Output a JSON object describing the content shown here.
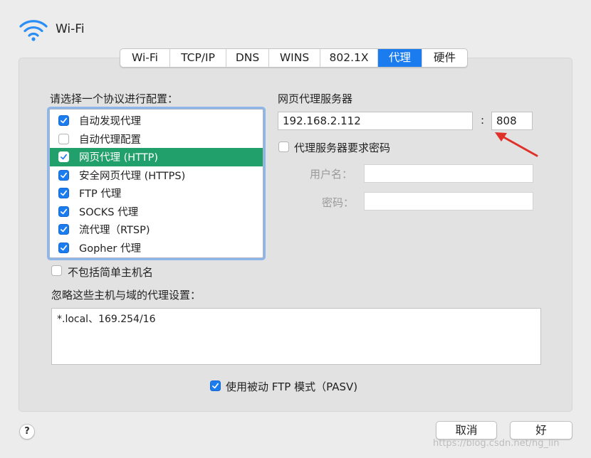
{
  "window": {
    "title": "Wi-Fi"
  },
  "tabs": [
    {
      "label": "Wi-Fi",
      "active": false
    },
    {
      "label": "TCP/IP",
      "active": false
    },
    {
      "label": "DNS",
      "active": false
    },
    {
      "label": "WINS",
      "active": false
    },
    {
      "label": "802.1X",
      "active": false
    },
    {
      "label": "代理",
      "active": true
    },
    {
      "label": "硬件",
      "active": false
    }
  ],
  "protocols": {
    "heading": "请选择一个协议进行配置：",
    "items": [
      {
        "label": "自动发现代理",
        "checked": true,
        "selected": false
      },
      {
        "label": "自动代理配置",
        "checked": false,
        "selected": false
      },
      {
        "label": "网页代理 (HTTP)",
        "checked": true,
        "selected": true
      },
      {
        "label": "安全网页代理 (HTTPS)",
        "checked": true,
        "selected": false
      },
      {
        "label": "FTP 代理",
        "checked": true,
        "selected": false
      },
      {
        "label": "SOCKS 代理",
        "checked": true,
        "selected": false
      },
      {
        "label": "流代理（RTSP)",
        "checked": true,
        "selected": false
      },
      {
        "label": "Gopher 代理",
        "checked": true,
        "selected": false
      }
    ]
  },
  "proxy_server": {
    "heading": "网页代理服务器",
    "host": "192.168.2.112",
    "separator": ":",
    "port": "808",
    "auth_label": "代理服务器要求密码",
    "auth_checked": false,
    "username_label": "用户名：",
    "username_value": "",
    "password_label": "密码：",
    "password_value": ""
  },
  "exclude_simple": {
    "label": "不包括简单主机名",
    "checked": false
  },
  "bypass": {
    "label": "忽略这些主机与域的代理设置：",
    "value": "*.local、169.254/16"
  },
  "passive_ftp": {
    "label": "使用被动 FTP 模式（PASV)",
    "checked": true
  },
  "buttons": {
    "help": "?",
    "cancel": "取消",
    "ok": "好"
  },
  "watermark": "https://blog.csdn.net/hg_lin",
  "colors": {
    "accent": "#1b7cf0",
    "selection": "#22a06b",
    "annotation_arrow": "#e0302a"
  }
}
